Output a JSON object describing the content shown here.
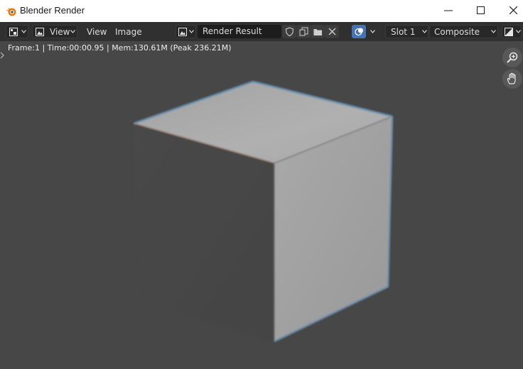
{
  "window": {
    "title": "Blender Render",
    "icon": "blender-logo-icon",
    "controls": [
      "minimize-icon",
      "maximize-icon",
      "close-icon"
    ]
  },
  "header": {
    "editor_type_icon": "image-editor-icon",
    "view_mode_label": "View",
    "menus": [
      "View",
      "Image"
    ],
    "image_icon": "image-icon",
    "image_name": "Render Result",
    "image_actions": [
      "fake-user-shield-icon",
      "duplicate-icon",
      "open-folder-icon",
      "unlink-x-icon"
    ],
    "overlay_icon": "overlay-icon",
    "slot": "Slot 1",
    "layer": "Composite",
    "display_channels_icon": "display-channels-icon"
  },
  "info": {
    "text": "Frame:1 | Time:00:00.95 | Mem:130.61M (Peak 236.21M)"
  },
  "nav": {
    "zoom_icon": "zoom-icon",
    "pan_icon": "hand-pan-icon"
  },
  "colors": {
    "background": "#474747",
    "header": "#303030",
    "accent_blue": "#4772b3"
  }
}
